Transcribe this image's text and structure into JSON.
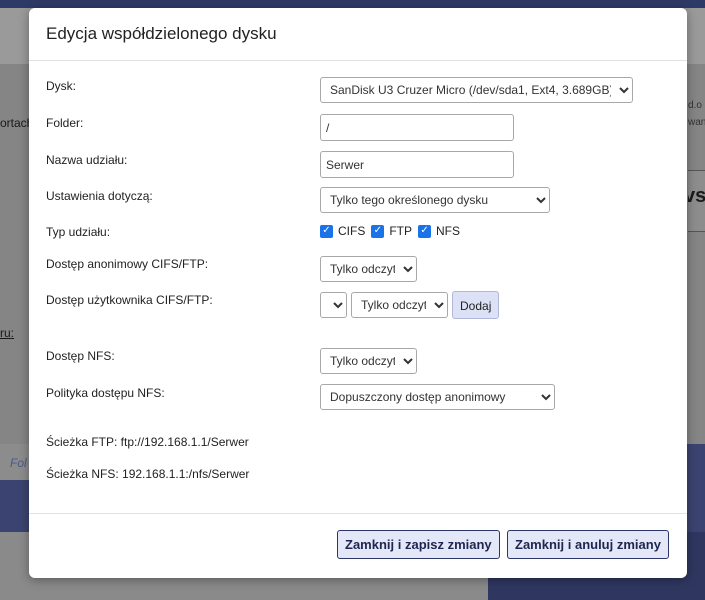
{
  "background": {
    "left_text_1": "ortach",
    "left_text_2": "ru:",
    "left_text_3": "Fol",
    "right_text_1": "d.o",
    "right_text_2": "wan",
    "right_text_3": "vs"
  },
  "modal": {
    "title": "Edycja współdzielonego dysku",
    "fields": {
      "disk": {
        "label": "Dysk:",
        "value": "SanDisk U3 Cruzer Micro (/dev/sda1, Ext4, 3.689GB)"
      },
      "folder": {
        "label": "Folder:",
        "value": "/"
      },
      "share_name": {
        "label": "Nazwa udziału:",
        "value": "Serwer"
      },
      "settings_apply": {
        "label": "Ustawienia dotyczą:",
        "value": "Tylko tego określonego dysku"
      },
      "share_type": {
        "label": "Typ udziału:",
        "options": [
          {
            "label": "CIFS",
            "checked": true
          },
          {
            "label": "FTP",
            "checked": true
          },
          {
            "label": "NFS",
            "checked": true
          }
        ]
      },
      "anon_access": {
        "label": "Dostęp anonimowy CIFS/FTP:",
        "value": "Tylko odczyt"
      },
      "user_access": {
        "label": "Dostęp użytkownika CIFS/FTP:",
        "user_value": "",
        "access_value": "Tylko odczyt",
        "add_label": "Dodaj"
      },
      "nfs_access": {
        "label": "Dostęp NFS:",
        "value": "Tylko odczyt"
      },
      "nfs_policy": {
        "label": "Polityka dostępu NFS:",
        "value": "Dopuszczony dostęp anonimowy"
      }
    },
    "paths": {
      "ftp": "Ścieżka FTP: ftp://192.168.1.1/Serwer",
      "nfs": "Ścieżka NFS: 192.168.1.1:/nfs/Serwer"
    },
    "buttons": {
      "save_close": "Zamknij i zapisz zmiany",
      "cancel_close": "Zamknij i anuluj zmiany"
    }
  }
}
